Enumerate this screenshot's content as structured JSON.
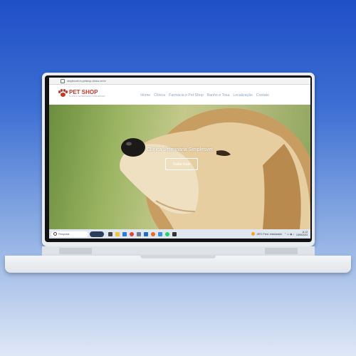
{
  "browser": {
    "url": "simplesvet.ev.petshop.clinica.vet.br"
  },
  "site": {
    "logo_title": "PET SHOP",
    "logo_subtitle": "CLINICA VETERINARIA SIMPLESVET",
    "nav": [
      "Home",
      "Clínica",
      "Farmácia e Pet Shop",
      "Banho e Tosa",
      "Localização",
      "Contato"
    ],
    "hero_title": "Clínica Veterinária Simplesvet",
    "hero_button": "Saiba mais"
  },
  "taskbar": {
    "search_label": "Pesquisar",
    "weather": "28°C  Pred. ensolarado",
    "time": "11:13",
    "date": "19/06/2023"
  },
  "colors": {
    "brand": "#c0392b",
    "nav": "#8da7bf",
    "background_top": "#1f4fc6"
  }
}
